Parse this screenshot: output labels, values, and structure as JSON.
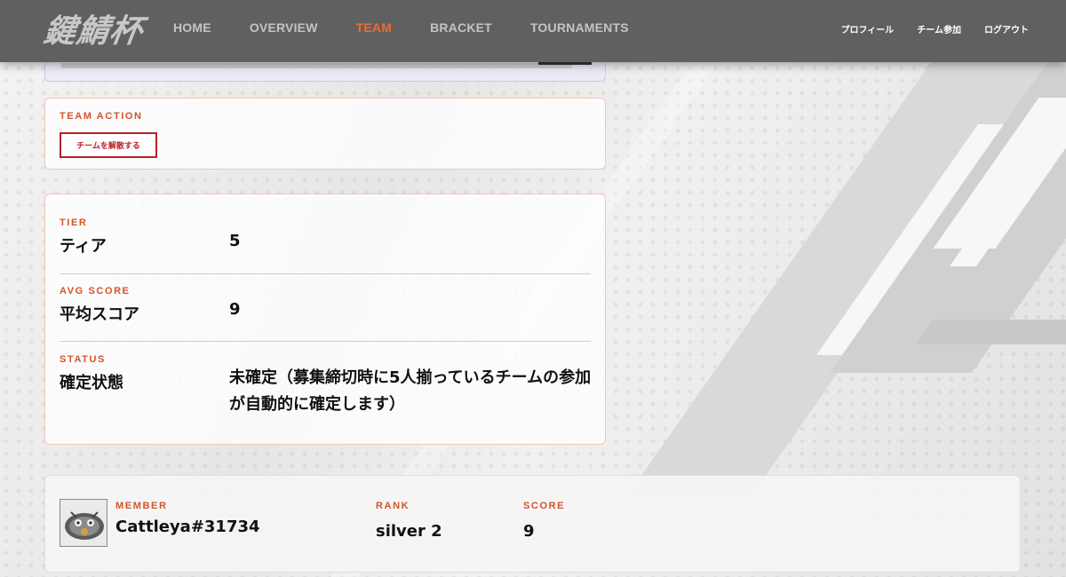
{
  "header": {
    "logo": "鍵鯖杯",
    "nav": [
      {
        "label": "HOME"
      },
      {
        "label": "OVERVIEW"
      },
      {
        "label": "TEAM",
        "active": true
      },
      {
        "label": "BRACKET"
      },
      {
        "label": "TOURNAMENTS"
      }
    ],
    "user_nav": [
      {
        "label": "プロフィール"
      },
      {
        "label": "チーム参加"
      },
      {
        "label": "ログアウト"
      }
    ],
    "accent_color": "#ef6a2e"
  },
  "team_action": {
    "label": "TEAM ACTION",
    "disband_button": "チームを解散する"
  },
  "team_info": {
    "tier": {
      "label": "TIER",
      "key": "ティア",
      "value": "5"
    },
    "avg_score": {
      "label": "AVG SCORE",
      "key": "平均スコア",
      "value": "9"
    },
    "status": {
      "label": "STATUS",
      "key": "確定状態",
      "value": "未確定（募集締切時に5人揃っているチームの参加が自動的に確定します）"
    }
  },
  "member": {
    "member_label": "MEMBER",
    "name": "Cattleya#31734",
    "rank_label": "RANK",
    "rank": "silver 2",
    "score_label": "SCORE",
    "score": "9",
    "avatar_icon": "avatar-icon"
  }
}
